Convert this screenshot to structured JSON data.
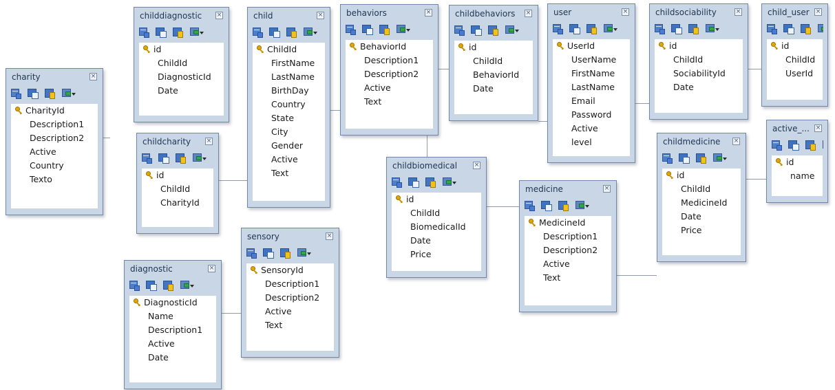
{
  "tables": [
    {
      "id": "charity",
      "title": "charity",
      "fields": [
        {
          "name": "CharityId",
          "pk": true
        },
        {
          "name": "Description1"
        },
        {
          "name": "Description2"
        },
        {
          "name": "Active"
        },
        {
          "name": "Country"
        },
        {
          "name": "Texto"
        }
      ]
    },
    {
      "id": "childdiagnostic",
      "title": "childdiagnostic",
      "fields": [
        {
          "name": "id",
          "pk": true
        },
        {
          "name": "ChildId"
        },
        {
          "name": "DiagnosticId"
        },
        {
          "name": "Date"
        }
      ]
    },
    {
      "id": "childcharity",
      "title": "childcharity",
      "fields": [
        {
          "name": "id",
          "pk": true
        },
        {
          "name": "ChildId"
        },
        {
          "name": "CharityId"
        }
      ]
    },
    {
      "id": "diagnostic",
      "title": "diagnostic",
      "fields": [
        {
          "name": "DiagnosticId",
          "pk": true
        },
        {
          "name": "Name"
        },
        {
          "name": "Description1"
        },
        {
          "name": "Active"
        },
        {
          "name": "Date"
        }
      ]
    },
    {
      "id": "child",
      "title": "child",
      "fields": [
        {
          "name": "ChildId",
          "pk": true
        },
        {
          "name": "FirstName"
        },
        {
          "name": "LastName"
        },
        {
          "name": "BirthDay"
        },
        {
          "name": "Country"
        },
        {
          "name": "State"
        },
        {
          "name": "City"
        },
        {
          "name": "Gender"
        },
        {
          "name": "Active"
        },
        {
          "name": "Text"
        }
      ]
    },
    {
      "id": "sensory",
      "title": "sensory",
      "fields": [
        {
          "name": "SensoryId",
          "pk": true
        },
        {
          "name": "Description1"
        },
        {
          "name": "Description2"
        },
        {
          "name": "Active"
        },
        {
          "name": "Text"
        }
      ]
    },
    {
      "id": "behaviors",
      "title": "behaviors",
      "fields": [
        {
          "name": "BehaviorId",
          "pk": true
        },
        {
          "name": "Description1"
        },
        {
          "name": "Description2"
        },
        {
          "name": "Active"
        },
        {
          "name": "Text"
        }
      ]
    },
    {
      "id": "childbiomedical",
      "title": "childbiomedical",
      "fields": [
        {
          "name": "id",
          "pk": true
        },
        {
          "name": "ChildId"
        },
        {
          "name": "BiomedicalId"
        },
        {
          "name": "Date"
        },
        {
          "name": "Price"
        }
      ]
    },
    {
      "id": "childbehaviors",
      "title": "childbehaviors",
      "fields": [
        {
          "name": "id",
          "pk": true
        },
        {
          "name": "ChildId"
        },
        {
          "name": "BehaviorId"
        },
        {
          "name": "Date"
        }
      ]
    },
    {
      "id": "medicine",
      "title": "medicine",
      "fields": [
        {
          "name": "MedicineId",
          "pk": true
        },
        {
          "name": "Description1"
        },
        {
          "name": "Description2"
        },
        {
          "name": "Active"
        },
        {
          "name": "Text"
        }
      ]
    },
    {
      "id": "user",
      "title": "user",
      "fields": [
        {
          "name": "UserId",
          "pk": true
        },
        {
          "name": "UserName"
        },
        {
          "name": "FirstName"
        },
        {
          "name": "LastName"
        },
        {
          "name": "Email"
        },
        {
          "name": "Password"
        },
        {
          "name": "Active"
        },
        {
          "name": "level"
        }
      ]
    },
    {
      "id": "childsociability",
      "title": "childsociability",
      "fields": [
        {
          "name": "id",
          "pk": true
        },
        {
          "name": "ChildId"
        },
        {
          "name": "SociabilityId"
        },
        {
          "name": "Date"
        }
      ]
    },
    {
      "id": "childmedicine",
      "title": "childmedicine",
      "fields": [
        {
          "name": "id",
          "pk": true
        },
        {
          "name": "ChildId"
        },
        {
          "name": "MedicineId"
        },
        {
          "name": "Date"
        },
        {
          "name": "Price"
        }
      ]
    },
    {
      "id": "child_user",
      "title": "child_user",
      "fields": [
        {
          "name": "id",
          "pk": true
        },
        {
          "name": "ChildId"
        },
        {
          "name": "UserId"
        }
      ]
    },
    {
      "id": "active",
      "title": "active_...",
      "fields": [
        {
          "name": "id",
          "pk": true
        },
        {
          "name": "name"
        }
      ]
    }
  ],
  "colors": {
    "window_frame": "#c9d6e6",
    "border": "#6f86a6",
    "field_area": "#ffffff",
    "title_text": "#1f3552",
    "key": "#e0a800"
  }
}
